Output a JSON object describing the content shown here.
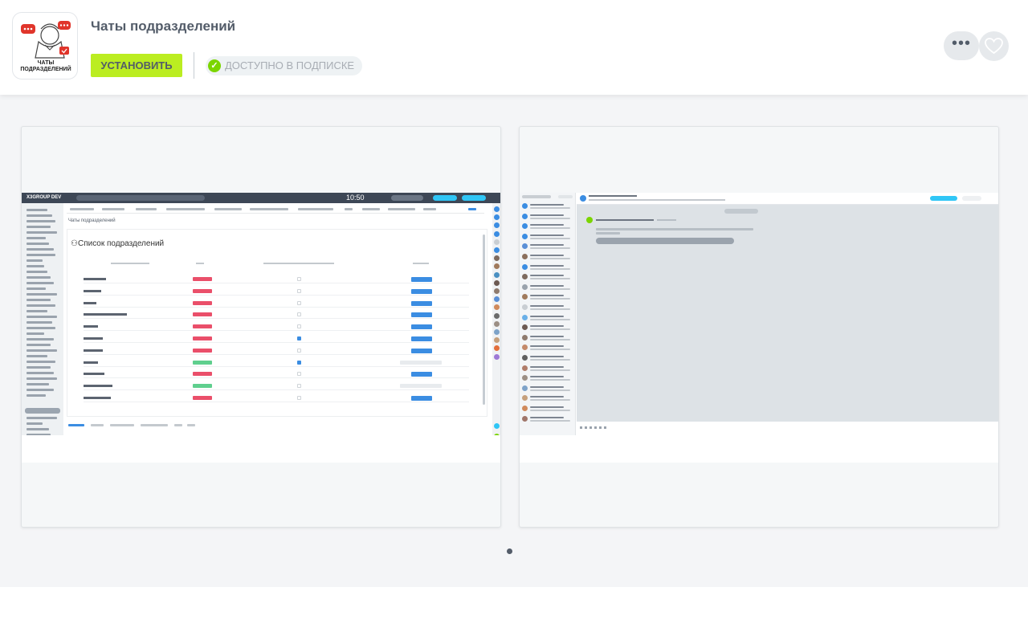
{
  "app": {
    "title": "Чаты подразделений",
    "icon_caption": "ЧАТЫ ПОДРАЗДЕЛЕНИЙ",
    "install_label": "Установить",
    "subscription_label": "Доступно в подписке"
  },
  "icons": {
    "more": "ellipsis-icon",
    "favorite": "heart-icon",
    "check": "check-circle-icon"
  },
  "colors": {
    "install_button": "#bbed21",
    "check": "#7bd500",
    "header_bg": "#ffffff",
    "gallery_bg": "#f4f5f7",
    "badge_red": "#ea4f6a",
    "badge_green": "#5fcf8e",
    "action_blue": "#3b8de2"
  },
  "screenshots": [
    {
      "logo": "X3GROUP DEV",
      "time": "10:50",
      "breadcrumb": "Чаты подразделений",
      "heading": "Список подразделений",
      "rows": [
        {
          "status": "red",
          "checked": false,
          "action": "blue"
        },
        {
          "status": "red",
          "checked": false,
          "action": "blue"
        },
        {
          "status": "red",
          "checked": false,
          "action": "blue"
        },
        {
          "status": "red",
          "checked": false,
          "action": "blue"
        },
        {
          "status": "red",
          "checked": false,
          "action": "blue"
        },
        {
          "status": "red",
          "checked": true,
          "action": "blue"
        },
        {
          "status": "red",
          "checked": false,
          "action": "blue"
        },
        {
          "status": "green",
          "checked": true,
          "action": "gray"
        },
        {
          "status": "red",
          "checked": false,
          "action": "blue"
        },
        {
          "status": "green",
          "checked": false,
          "action": "gray"
        },
        {
          "status": "red",
          "checked": false,
          "action": "blue"
        }
      ]
    },
    {
      "chat_items": 22
    }
  ],
  "pagination": {
    "pages": 1,
    "active": 0
  }
}
